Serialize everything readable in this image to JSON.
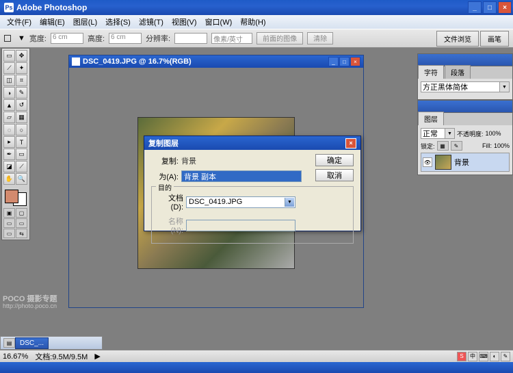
{
  "app": {
    "title": "Adobe Photoshop"
  },
  "winbtns": {
    "min": "_",
    "max": "□",
    "close": "×"
  },
  "menu": [
    "文件(F)",
    "编辑(E)",
    "图层(L)",
    "选择(S)",
    "滤镜(T)",
    "视图(V)",
    "窗口(W)",
    "帮助(H)"
  ],
  "options": {
    "width_label": "宽度:",
    "width_val": "6 cm",
    "height_label": "高度:",
    "height_val": "6 cm",
    "res_label": "分辨率:",
    "res_unit": "像素/英寸",
    "btn1": "前面的图像",
    "btn2": "清除",
    "tab1": "文件浏览",
    "tab2": "画笔"
  },
  "doc": {
    "title": "DSC_0419.JPG @ 16.7%(RGB)"
  },
  "dialog": {
    "title": "复制图层",
    "dup_label": "复制:",
    "dup_val": "背景",
    "as_label": "为(A):",
    "as_val": "背景 副本",
    "dest_legend": "目的",
    "doc_label": "文档(D):",
    "doc_val": "DSC_0419.JPG",
    "name_label": "名称(N):",
    "ok": "确定",
    "cancel": "取消"
  },
  "palettes": {
    "char_tab": "字符",
    "para_tab": "段落",
    "font": "方正黑体简体",
    "layer_tab": "图层",
    "blend": "正常",
    "opacity_label": "不透明度:",
    "opacity": "100%",
    "lock_label": "锁定:",
    "fill_label": "Fill:",
    "fill": "100%",
    "layer_name": "背景"
  },
  "status": {
    "zoom": "16.67%",
    "docsize": "文档:9.5M/9.5M"
  },
  "doctab": {
    "name": "DSC_..."
  },
  "watermark": {
    "brand": "POCO 摄影专题",
    "url": "http://photo.poco.cn"
  },
  "tray": {
    "s": "S",
    "zh": "中"
  },
  "icons": {
    "eye": "👁",
    "arrow": "▼",
    "play": "▶",
    "ps": "Ps"
  }
}
